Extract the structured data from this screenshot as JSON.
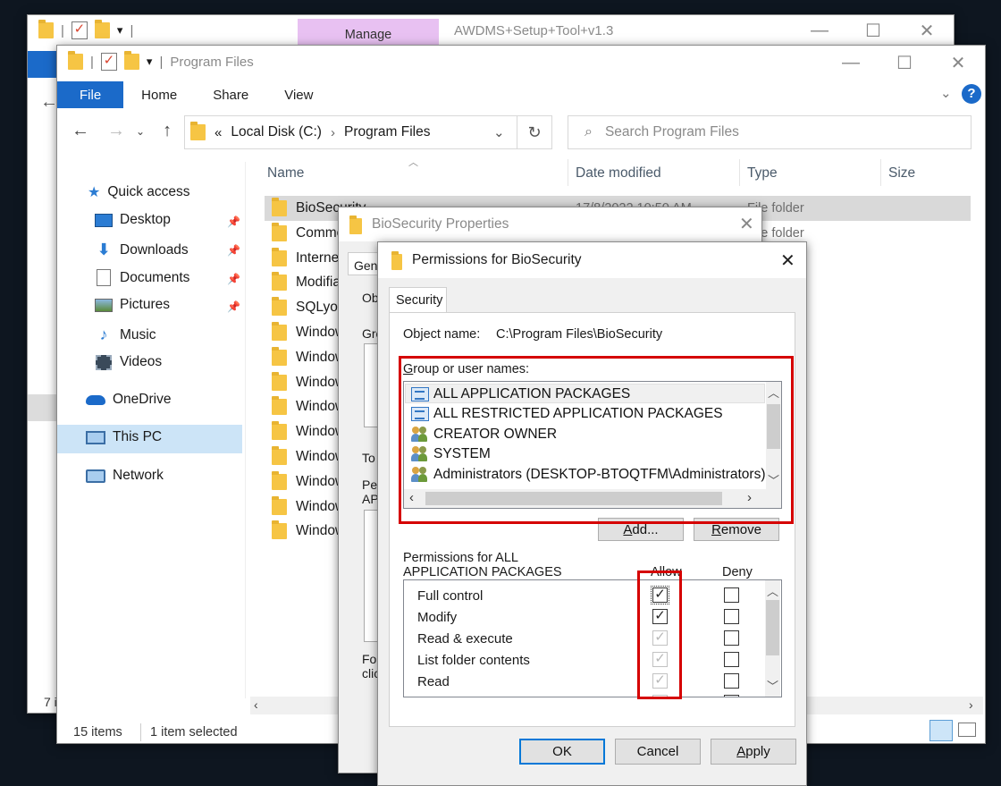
{
  "back_window": {
    "manage_tab": "Manage",
    "title": "AWDMS+Setup+Tool+v1.3",
    "status_partial": "7 i"
  },
  "explorer": {
    "title": "Program Files",
    "ribbon_tabs": [
      "File",
      "Home",
      "Share",
      "View"
    ],
    "breadcrumb_prefix": "«",
    "breadcrumb": [
      "Local Disk (C:)",
      "Program Files"
    ],
    "search_placeholder": "Search Program Files",
    "columns": [
      "Name",
      "Date modified",
      "Type",
      "Size"
    ],
    "sidebar": [
      {
        "label": "Quick access",
        "icon": "star-icon"
      },
      {
        "label": "Desktop",
        "icon": "desktop-icon",
        "pinned": true
      },
      {
        "label": "Downloads",
        "icon": "download-icon",
        "pinned": true
      },
      {
        "label": "Documents",
        "icon": "document-icon",
        "pinned": true
      },
      {
        "label": "Pictures",
        "icon": "picture-icon",
        "pinned": true
      },
      {
        "label": "Music",
        "icon": "music-icon"
      },
      {
        "label": "Videos",
        "icon": "video-icon"
      },
      {
        "label": "OneDrive",
        "icon": "cloud-icon"
      },
      {
        "label": "This PC",
        "icon": "computer-icon"
      },
      {
        "label": "Network",
        "icon": "network-icon"
      }
    ],
    "files": [
      {
        "name": "BioSecurity",
        "date": "17/8/2022 10:50 AM",
        "type": "File folder",
        "selected": true
      },
      {
        "name": "Common Files",
        "date": "",
        "type": "File folder"
      },
      {
        "name": "Internet Explorer",
        "date": "",
        "type": ""
      },
      {
        "name": "Modifiable Windows Apps",
        "date": "",
        "type": ""
      },
      {
        "name": "SQLyog",
        "date": "",
        "type": ""
      },
      {
        "name": "Windows Defender",
        "date": "",
        "type": ""
      },
      {
        "name": "Windows Defender Advanced Threat Protection",
        "date": "",
        "type": ""
      },
      {
        "name": "Windows Mail",
        "date": "",
        "type": ""
      },
      {
        "name": "Windows Media Player",
        "date": "",
        "type": ""
      },
      {
        "name": "Windows Multimedia Platform",
        "date": "",
        "type": ""
      },
      {
        "name": "Windows NT",
        "date": "",
        "type": ""
      },
      {
        "name": "Windows Photo Viewer",
        "date": "",
        "type": ""
      },
      {
        "name": "Windows Portable Devices",
        "date": "",
        "type": ""
      },
      {
        "name": "WindowsPowerShell",
        "date": "",
        "type": ""
      }
    ],
    "status_items": "15 items",
    "status_selected": "1 item selected"
  },
  "properties_dialog": {
    "title": "BioSecurity Properties",
    "tab_partial": "Gen",
    "partial_texts": [
      "Ob",
      "Gro",
      "To",
      "Pe",
      "AP",
      "Fo",
      "clic"
    ]
  },
  "permissions_dialog": {
    "title": "Permissions for BioSecurity",
    "tab": "Security",
    "object_label": "Object name:",
    "object_value": "C:\\Program Files\\BioSecurity",
    "group_label": "Group or user names:",
    "users": [
      {
        "name": "ALL APPLICATION PACKAGES",
        "icon": "package-icon",
        "selected": true
      },
      {
        "name": "ALL RESTRICTED APPLICATION PACKAGES",
        "icon": "package-icon"
      },
      {
        "name": "CREATOR OWNER",
        "icon": "users-icon"
      },
      {
        "name": "SYSTEM",
        "icon": "users-icon"
      },
      {
        "name": "Administrators (DESKTOP-BTOQTFM\\Administrators)",
        "icon": "users-icon"
      }
    ],
    "add_button": "Add...",
    "remove_button": "Remove",
    "perm_label_line1": "Permissions for ALL",
    "perm_label_line2": "APPLICATION PACKAGES",
    "allow_header": "Allow",
    "deny_header": "Deny",
    "permissions": [
      {
        "name": "Full control",
        "allow": true,
        "allow_disabled": false,
        "deny": false
      },
      {
        "name": "Modify",
        "allow": true,
        "allow_disabled": false,
        "deny": false
      },
      {
        "name": "Read & execute",
        "allow": true,
        "allow_disabled": true,
        "deny": false
      },
      {
        "name": "List folder contents",
        "allow": true,
        "allow_disabled": true,
        "deny": false
      },
      {
        "name": "Read",
        "allow": true,
        "allow_disabled": true,
        "deny": false
      }
    ],
    "ok_button": "OK",
    "cancel_button": "Cancel",
    "apply_button": "Apply"
  },
  "colors": {
    "highlight": "#d50000",
    "accent": "#1b6ac9",
    "manage_tab": "#e8c1f2"
  }
}
